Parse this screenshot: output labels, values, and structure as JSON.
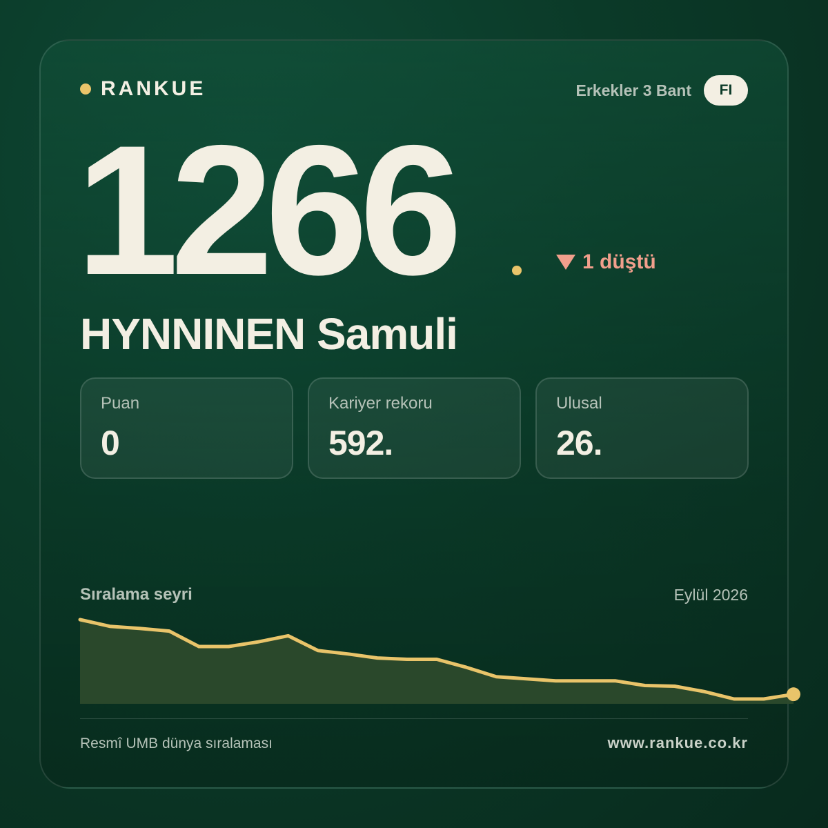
{
  "brand": {
    "name": "RANKUE"
  },
  "header": {
    "category": "Erkekler 3 Bant",
    "country": "FI"
  },
  "rank": {
    "value": "1266",
    "change_text": "1 düştü",
    "change_direction": "down"
  },
  "player": {
    "name": "HYNNINEN Samuli"
  },
  "stats": [
    {
      "label": "Puan",
      "value": "0"
    },
    {
      "label": "Kariyer rekoru",
      "value": "592."
    },
    {
      "label": "Ulusal",
      "value": "26."
    }
  ],
  "trend": {
    "title": "Sıralama seyri",
    "date": "Eylül 2026"
  },
  "chart_data": {
    "type": "area",
    "series": [
      {
        "values": [
          1155,
          1165,
          1168,
          1172,
          1195,
          1195,
          1188,
          1179,
          1201,
          1206,
          1212,
          1214,
          1214,
          1226,
          1240,
          1243,
          1246,
          1246,
          1246,
          1253,
          1254,
          1262,
          1273,
          1273,
          1266
        ]
      }
    ],
    "y_direction": "inverted"
  },
  "footer": {
    "source": "Resmî UMB dünya sıralaması",
    "website": "www.rankue.co.kr"
  },
  "colors": {
    "accent": "#e9c46a",
    "decline": "#f19f8c",
    "text_primary": "#f3efe3",
    "text_muted": "#b5c2b8",
    "area_fill": "#2c4a2c"
  }
}
